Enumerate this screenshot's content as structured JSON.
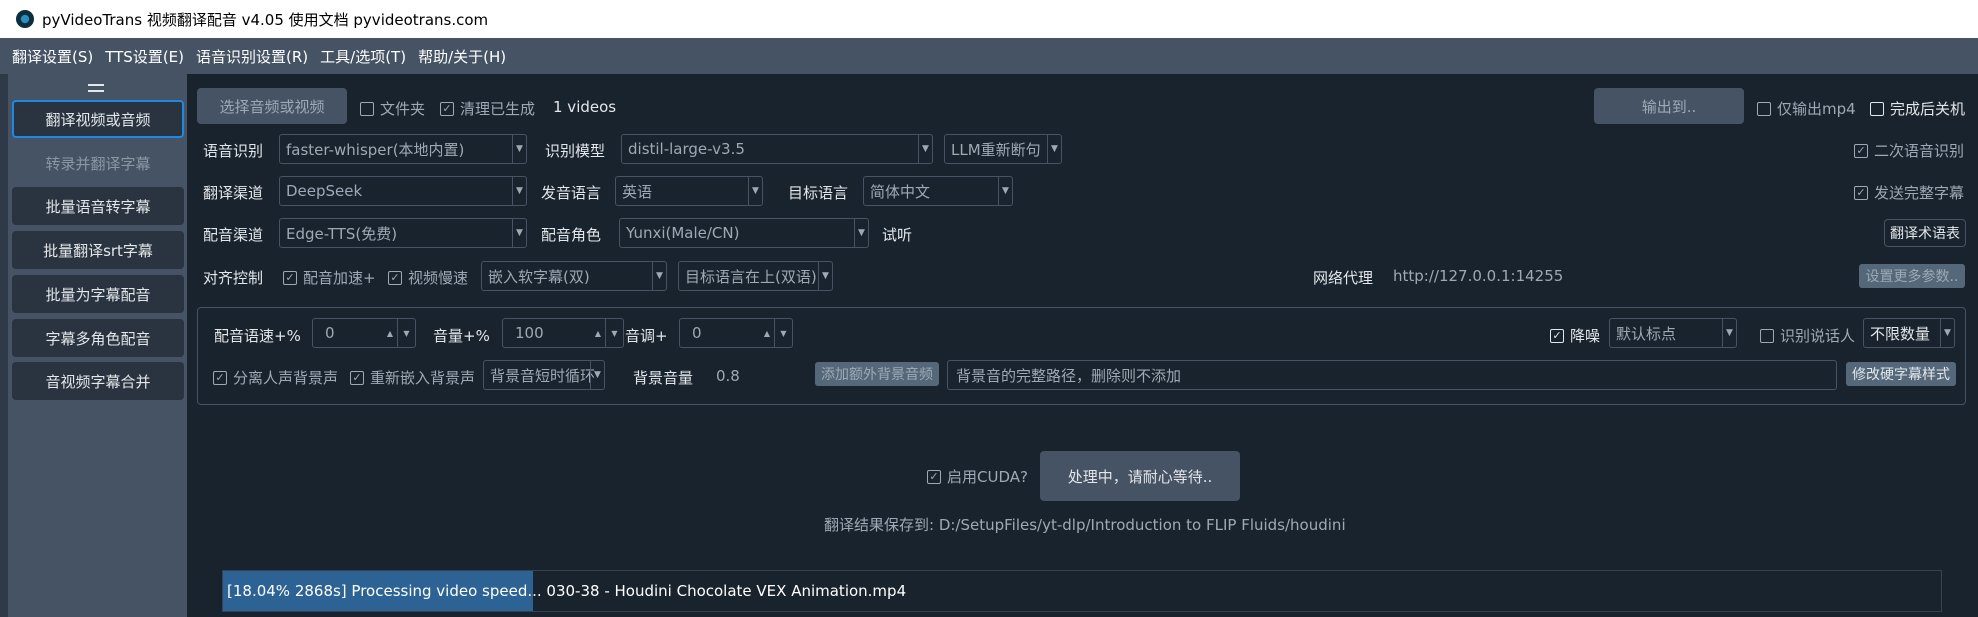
{
  "window": {
    "title": "pyVideoTrans 视频翻译配音 v4.05 使用文档 pyvideotrans.com"
  },
  "menu": [
    "翻译设置(S)",
    "TTS设置(E)",
    "语音识别设置(R)",
    "工具/选项(T)",
    "帮助/关于(H)"
  ],
  "sidebar": {
    "items": [
      {
        "label": "翻译视频或音频",
        "state": "active"
      },
      {
        "label": "转录并翻译字幕",
        "state": "disabled"
      },
      {
        "label": "批量语音转字幕",
        "state": "normal"
      },
      {
        "label": "批量翻译srt字幕",
        "state": "normal"
      },
      {
        "label": "批量为字幕配音",
        "state": "normal"
      },
      {
        "label": "字幕多角色配音",
        "state": "normal"
      },
      {
        "label": "音视频字幕合并",
        "state": "normal"
      }
    ]
  },
  "top": {
    "select_button": "选择音频或视频",
    "folder_label": "文件夹",
    "folder_checked": false,
    "clean_label": "清理已生成",
    "clean_checked": true,
    "count": "1 videos",
    "output_button": "输出到..",
    "only_mp4_label": "仅输出mp4",
    "only_mp4_checked": false,
    "shutdown_label": "完成后关机",
    "shutdown_checked": false
  },
  "row_asr": {
    "label": "语音识别",
    "engine": "faster-whisper(本地内置)",
    "model_label": "识别模型",
    "model": "distil-large-v3.5",
    "split": "LLM重新断句",
    "second_label": "二次语音识别",
    "second_checked": true
  },
  "row_translate": {
    "label": "翻译渠道",
    "channel": "DeepSeek",
    "src_label": "发音语言",
    "src": "英语",
    "tgt_label": "目标语言",
    "tgt": "简体中文",
    "full_label": "发送完整字幕",
    "full_checked": true
  },
  "row_tts": {
    "label": "配音渠道",
    "channel": "Edge-TTS(免费)",
    "role_label": "配音角色",
    "role": "Yunxi(Male/CN)",
    "listen": "试听",
    "glossary_button": "翻译术语表"
  },
  "row_align": {
    "label": "对齐控制",
    "speedup_label": "配音加速+",
    "speedup_checked": true,
    "slow_label": "视频慢速",
    "slow_checked": true,
    "subtitle_mode": "嵌入软字幕(双)",
    "subtitle_pos": "目标语言在上(双语)",
    "proxy_label": "网络代理",
    "proxy_value": "http://127.0.0.1:14255",
    "more_button": "设置更多参数.."
  },
  "params": {
    "rate_label": "配音语速+%",
    "rate_value": "0",
    "volume_label": "音量+%",
    "volume_value": "100",
    "pitch_label": "音调+",
    "pitch_value": "0",
    "denoise_label": "降噪",
    "denoise_checked": true,
    "punct": "默认标点",
    "speaker_label": "识别说话人",
    "speaker_checked": false,
    "speaker_count": "不限数量",
    "separate_label": "分离人声背景声",
    "separate_checked": true,
    "reembed_label": "重新嵌入背景声",
    "reembed_checked": true,
    "bg_mode": "背景音短时循环",
    "bg_volume_label": "背景音量",
    "bg_volume_value": "0.8",
    "add_bg_button": "添加额外背景音频",
    "bg_path_placeholder": "背景音的完整路径，删除则不添加",
    "hard_sub_button": "修改硬字幕样式"
  },
  "bottom": {
    "cuda_label": "启用CUDA?",
    "cuda_checked": true,
    "process_button": "处理中，请耐心等待..",
    "save_path": "翻译结果保存到: D:/SetupFiles/yt-dlp/Introduction to FLIP Fluids/houdini"
  },
  "progress": {
    "fraction": 0.1804,
    "text": "[18.04%  2868s]  Processing video speed... 030-38 - Houdini Chocolate VEX Animation.mp4"
  },
  "colors": {
    "accent": "#1e88e5",
    "progress_fill": "#2c6394",
    "panel": "#19232d",
    "sidebar": "#455364"
  }
}
